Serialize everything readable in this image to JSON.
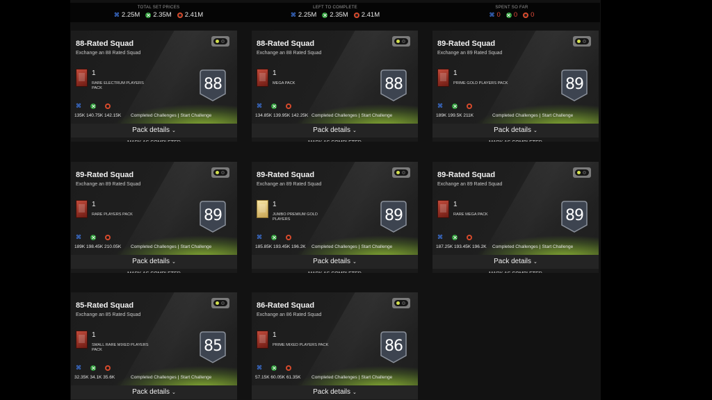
{
  "summary": [
    {
      "label": "TOTAL SET PRICES",
      "ps": "2.25M",
      "xbox": "2.35M",
      "pc": "2.41M",
      "zero": false
    },
    {
      "label": "LEFT TO COMPLETE",
      "ps": "2.25M",
      "xbox": "2.35M",
      "pc": "2.41M",
      "zero": false
    },
    {
      "label": "SPENT SO FAR",
      "ps": "0",
      "xbox": "0",
      "pc": "0",
      "zero": true
    }
  ],
  "labels": {
    "completed": "Completed Challenges",
    "start": "Start Challenge",
    "sep": "|",
    "pack_details": "Pack details",
    "mark": "MARK AS COMPLETED",
    "chevron": "⌄"
  },
  "cards": [
    {
      "title": "88-Rated Squad",
      "sub": "Exchange an 88 Rated Squad",
      "qty": "1",
      "pack": "RARE ELECTRUM PLAYERS PACK",
      "rating": "88",
      "prices": "135K 140.75K 142.15K",
      "gold": false
    },
    {
      "title": "88-Rated Squad",
      "sub": "Exchange an 88 Rated Squad",
      "qty": "1",
      "pack": "MEGA PACK",
      "rating": "88",
      "prices": "134.85K 139.95K 142.25K",
      "gold": false
    },
    {
      "title": "89-Rated Squad",
      "sub": "Exchange an 89 Rated Squad",
      "qty": "1",
      "pack": "PRIME GOLD PLAYERS PACK",
      "rating": "89",
      "prices": "189K 199.5K 211K",
      "gold": false
    },
    {
      "title": "89-Rated Squad",
      "sub": "Exchange an 89 Rated Squad",
      "qty": "1",
      "pack": "RARE PLAYERS PACK",
      "rating": "89",
      "prices": "189K 198.45K 210.05K",
      "gold": false
    },
    {
      "title": "89-Rated Squad",
      "sub": "Exchange an 89 Rated Squad",
      "qty": "1",
      "pack": "JUMBO PREMIUM GOLD PLAYERS",
      "rating": "89",
      "prices": "185.85K 193.45K 196.2K",
      "gold": true
    },
    {
      "title": "89-Rated Squad",
      "sub": "Exchange an 89 Rated Squad",
      "qty": "1",
      "pack": "RARE MEGA PACK",
      "rating": "89",
      "prices": "187.25K 193.45K 196.2K",
      "gold": false
    },
    {
      "title": "85-Rated Squad",
      "sub": "Exchange an 85 Rated Squad",
      "qty": "1",
      "pack": "SMALL RARE MIXED PLAYERS PACK",
      "rating": "85",
      "prices": "32.35K 34.1K 35.6K",
      "gold": false
    },
    {
      "title": "86-Rated Squad",
      "sub": "Exchange an 86 Rated Squad",
      "qty": "1",
      "pack": "PRIME MIXED PLAYERS PACK",
      "rating": "86",
      "prices": "57.15K 60.05K 61.35K",
      "gold": false
    }
  ],
  "icons": {
    "ps": "playstation-icon",
    "xbox": "xbox-icon",
    "pc": "origin-icon",
    "toggle": "toggle-icon"
  },
  "colors": {
    "accent_green": "#97c436",
    "ps_blue": "#3b6fd1",
    "xbox_green": "#2f9b3a",
    "pc_orange": "#d64a2c",
    "zero_red": "#e04b3a"
  }
}
